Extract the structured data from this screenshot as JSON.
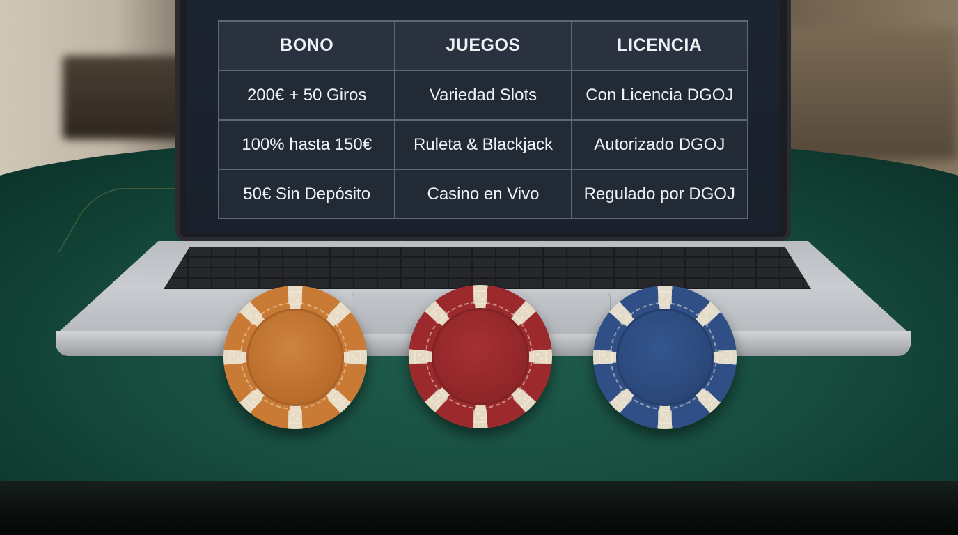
{
  "table": {
    "headers": [
      "BONO",
      "JUEGOS",
      "LICENCIA"
    ],
    "rows": [
      [
        "200€ + 50 Giros",
        "Variedad Slots",
        "Con Licencia DGOJ"
      ],
      [
        "100% hasta 150€",
        "Ruleta & Blackjack",
        "Autorizado DGOJ"
      ],
      [
        "50€ Sin Depósito",
        "Casino en Vivo",
        "Regulado por DGOJ"
      ]
    ]
  },
  "chips": [
    {
      "color_name": "orange",
      "color": "#c97a34"
    },
    {
      "color_name": "red",
      "color": "#9c2a2c"
    },
    {
      "color_name": "blue",
      "color": "#2f4f86"
    }
  ],
  "colors": {
    "felt": "#1f5d4c",
    "screen_bg": "#1c2430",
    "table_border": "#5b6678",
    "laptop_silver": "#c9ccd1"
  }
}
